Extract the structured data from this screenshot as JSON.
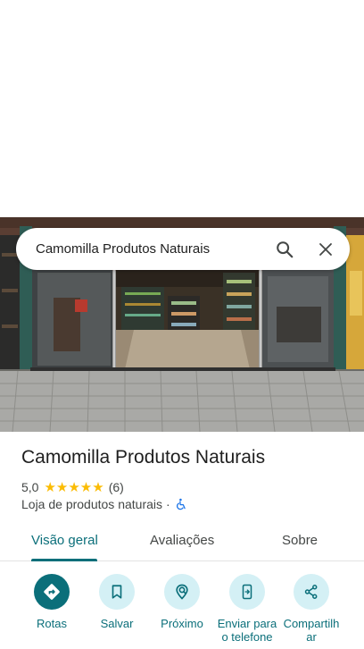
{
  "search": {
    "query": "Camomilla Produtos Naturais"
  },
  "place": {
    "name": "Camomilla Produtos Naturais",
    "rating": "5,0",
    "stars": "★★★★★",
    "review_count": "(6)",
    "category": "Loja de produtos naturais",
    "separator": "·"
  },
  "tabs": [
    {
      "label": "Visão geral",
      "active": true
    },
    {
      "label": "Avaliações",
      "active": false
    },
    {
      "label": "Sobre",
      "active": false
    }
  ],
  "actions": [
    {
      "label": "Rotas",
      "icon": "directions-icon"
    },
    {
      "label": "Salvar",
      "icon": "bookmark-icon"
    },
    {
      "label": "Próximo",
      "icon": "nearby-icon"
    },
    {
      "label": "Enviar para o telefone",
      "icon": "send-to-phone-icon"
    },
    {
      "label": "Compartilhar",
      "icon": "share-icon"
    }
  ],
  "colors": {
    "accent": "#0b6f7a",
    "action_bg": "#d4f0f5",
    "star": "#fbbc04"
  }
}
